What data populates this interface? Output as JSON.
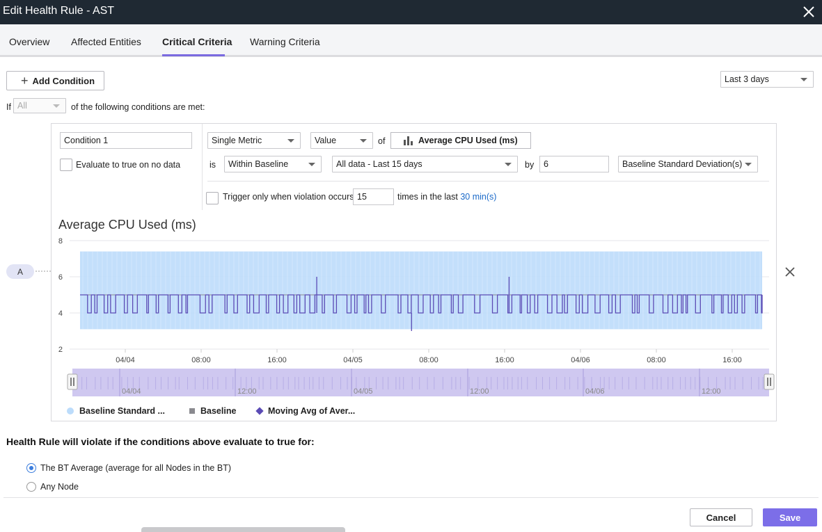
{
  "window": {
    "title": "Edit Health Rule - AST"
  },
  "tabs": [
    {
      "label": "Overview"
    },
    {
      "label": "Affected Entities"
    },
    {
      "label": "Critical Criteria"
    },
    {
      "label": "Warning Criteria"
    }
  ],
  "toolbar": {
    "add_condition_label": "Add Condition",
    "time_range": "Last 3 days"
  },
  "match": {
    "prefix": "If",
    "selector": "All",
    "suffix": "of the following conditions are met:"
  },
  "condition": {
    "name": "Condition 1",
    "no_data_label": "Evaluate to true on no data",
    "metric_type": "Single Metric",
    "value_type": "Value",
    "of_label": "of",
    "metric_name": "Average CPU Used (ms)",
    "is_label": "is",
    "operator": "Within Baseline",
    "baseline": "All data - Last 15 days",
    "by_label": "by",
    "by_value": "6",
    "unit": "Baseline Standard Deviation(s)",
    "trigger_label": "Trigger only when violation occurs",
    "trigger_count": "15",
    "times_label": "times in the last",
    "window_link": "30 min(s)",
    "badge": "A"
  },
  "chart_data": {
    "type": "line",
    "title": "Average CPU Used (ms)",
    "y_ticks": [
      8,
      6,
      4,
      2
    ],
    "ylim": [
      2,
      8
    ],
    "x_ticks": [
      "04/04",
      "08:00",
      "16:00",
      "04/05",
      "08:00",
      "16:00",
      "04/06",
      "08:00",
      "16:00"
    ],
    "navigator_ticks": [
      "04/04",
      "12:00",
      "04/05",
      "12:00",
      "04/06",
      "12:00"
    ],
    "baseline_band": [
      3.1,
      7.4
    ],
    "baseline_value": 5,
    "series": [
      {
        "name": "Baseline Standard ...",
        "color": "#bcdcfb",
        "marker": "circle"
      },
      {
        "name": "Baseline",
        "color": "#8a8a8f",
        "marker": "square"
      },
      {
        "name": "Moving Avg of Aver...",
        "color": "#5b4bb5",
        "marker": "diamond",
        "base": 4,
        "high": 5,
        "spikes": [
          {
            "x": 0.347,
            "y": 6
          },
          {
            "x": 0.486,
            "y": 3
          },
          {
            "x": 0.629,
            "y": 6
          }
        ]
      }
    ]
  },
  "violation": {
    "heading": "Health Rule will violate if the conditions above evaluate to true for:",
    "options": [
      {
        "label": "The BT Average (average for all Nodes in the BT)",
        "selected": true
      },
      {
        "label": "Any Node",
        "selected": false
      }
    ]
  },
  "footer": {
    "cancel_label": "Cancel",
    "save_label": "Save"
  },
  "colors": {
    "accent": "#7c6ee8",
    "titlebar": "#1f2933",
    "link": "#1b6ac9"
  }
}
